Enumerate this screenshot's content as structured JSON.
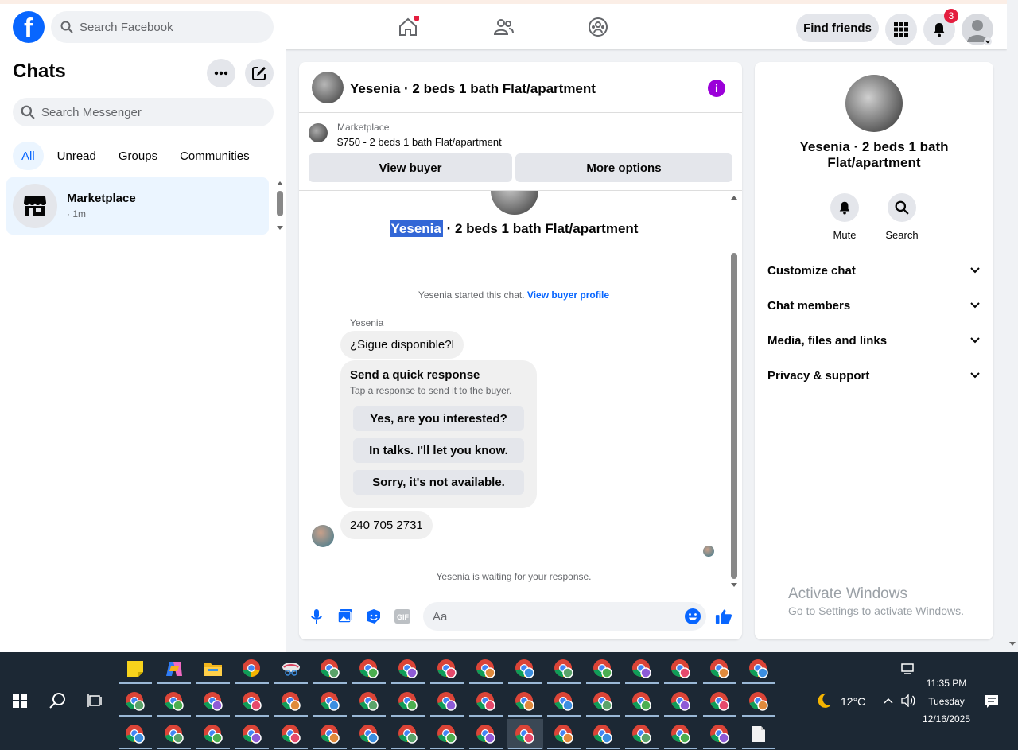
{
  "topbar": {
    "search_placeholder": "Search Facebook",
    "find_friends": "Find friends",
    "notification_count": "3",
    "colors": {
      "brand": "#0866ff",
      "badge": "#e41e3f"
    }
  },
  "left": {
    "title": "Chats",
    "search_placeholder": "Search Messenger",
    "filters": [
      "All",
      "Unread",
      "Groups",
      "Communities"
    ],
    "chat": {
      "name": "Marketplace",
      "time": "· 1m"
    }
  },
  "conversation": {
    "header_title": "Yesenia · 2 beds 1 bath Flat/apartment",
    "market_label": "Marketplace",
    "market_price": "$750 - 2 beds 1 bath Flat/apartment",
    "view_buyer": "View buyer",
    "more_options": "More options",
    "title_highlight": "Yesenia",
    "title_rest": " · 2 beds 1 bath Flat/apartment",
    "started_text": "Yesenia started this chat. ",
    "view_profile": "View buyer profile",
    "sender": "Yesenia",
    "message1": "¿Sigue disponible?l",
    "quick_title": "Send a quick response",
    "quick_sub": "Tap a response to send it to the buyer.",
    "quick_options": [
      "Yes, are you interested?",
      "In talks. I'll let you know.",
      "Sorry, it's not available."
    ],
    "message2": "240 705 2731",
    "waiting": "Yesenia is waiting for your response.",
    "input_placeholder": "Aa"
  },
  "right": {
    "title": "Yesenia · 2 beds 1 bath Flat/apartment",
    "mute": "Mute",
    "search": "Search",
    "sections": [
      "Customize chat",
      "Chat members",
      "Media, files and links",
      "Privacy & support"
    ]
  },
  "watermark": {
    "line1": "Activate Windows",
    "line2": "Go to Settings to activate Windows."
  },
  "taskbar": {
    "weather": "12°C",
    "time": "11:35 PM",
    "day": "Tuesday",
    "date": "12/16/2025"
  }
}
